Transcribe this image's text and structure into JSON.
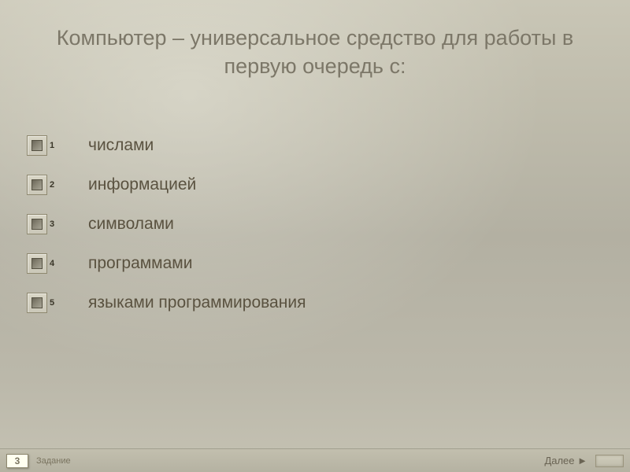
{
  "title": "Компьютер – универсальное средство для работы в первую очередь с:",
  "options": [
    {
      "num": "1",
      "text": "числами"
    },
    {
      "num": "2",
      "text": "информацией"
    },
    {
      "num": "3",
      "text": "символами"
    },
    {
      "num": "4",
      "text": "программами"
    },
    {
      "num": "5",
      "text": "языками программирования"
    }
  ],
  "footer": {
    "page_num": "3",
    "page_label": "Задание",
    "next_label": "Далее ►"
  }
}
